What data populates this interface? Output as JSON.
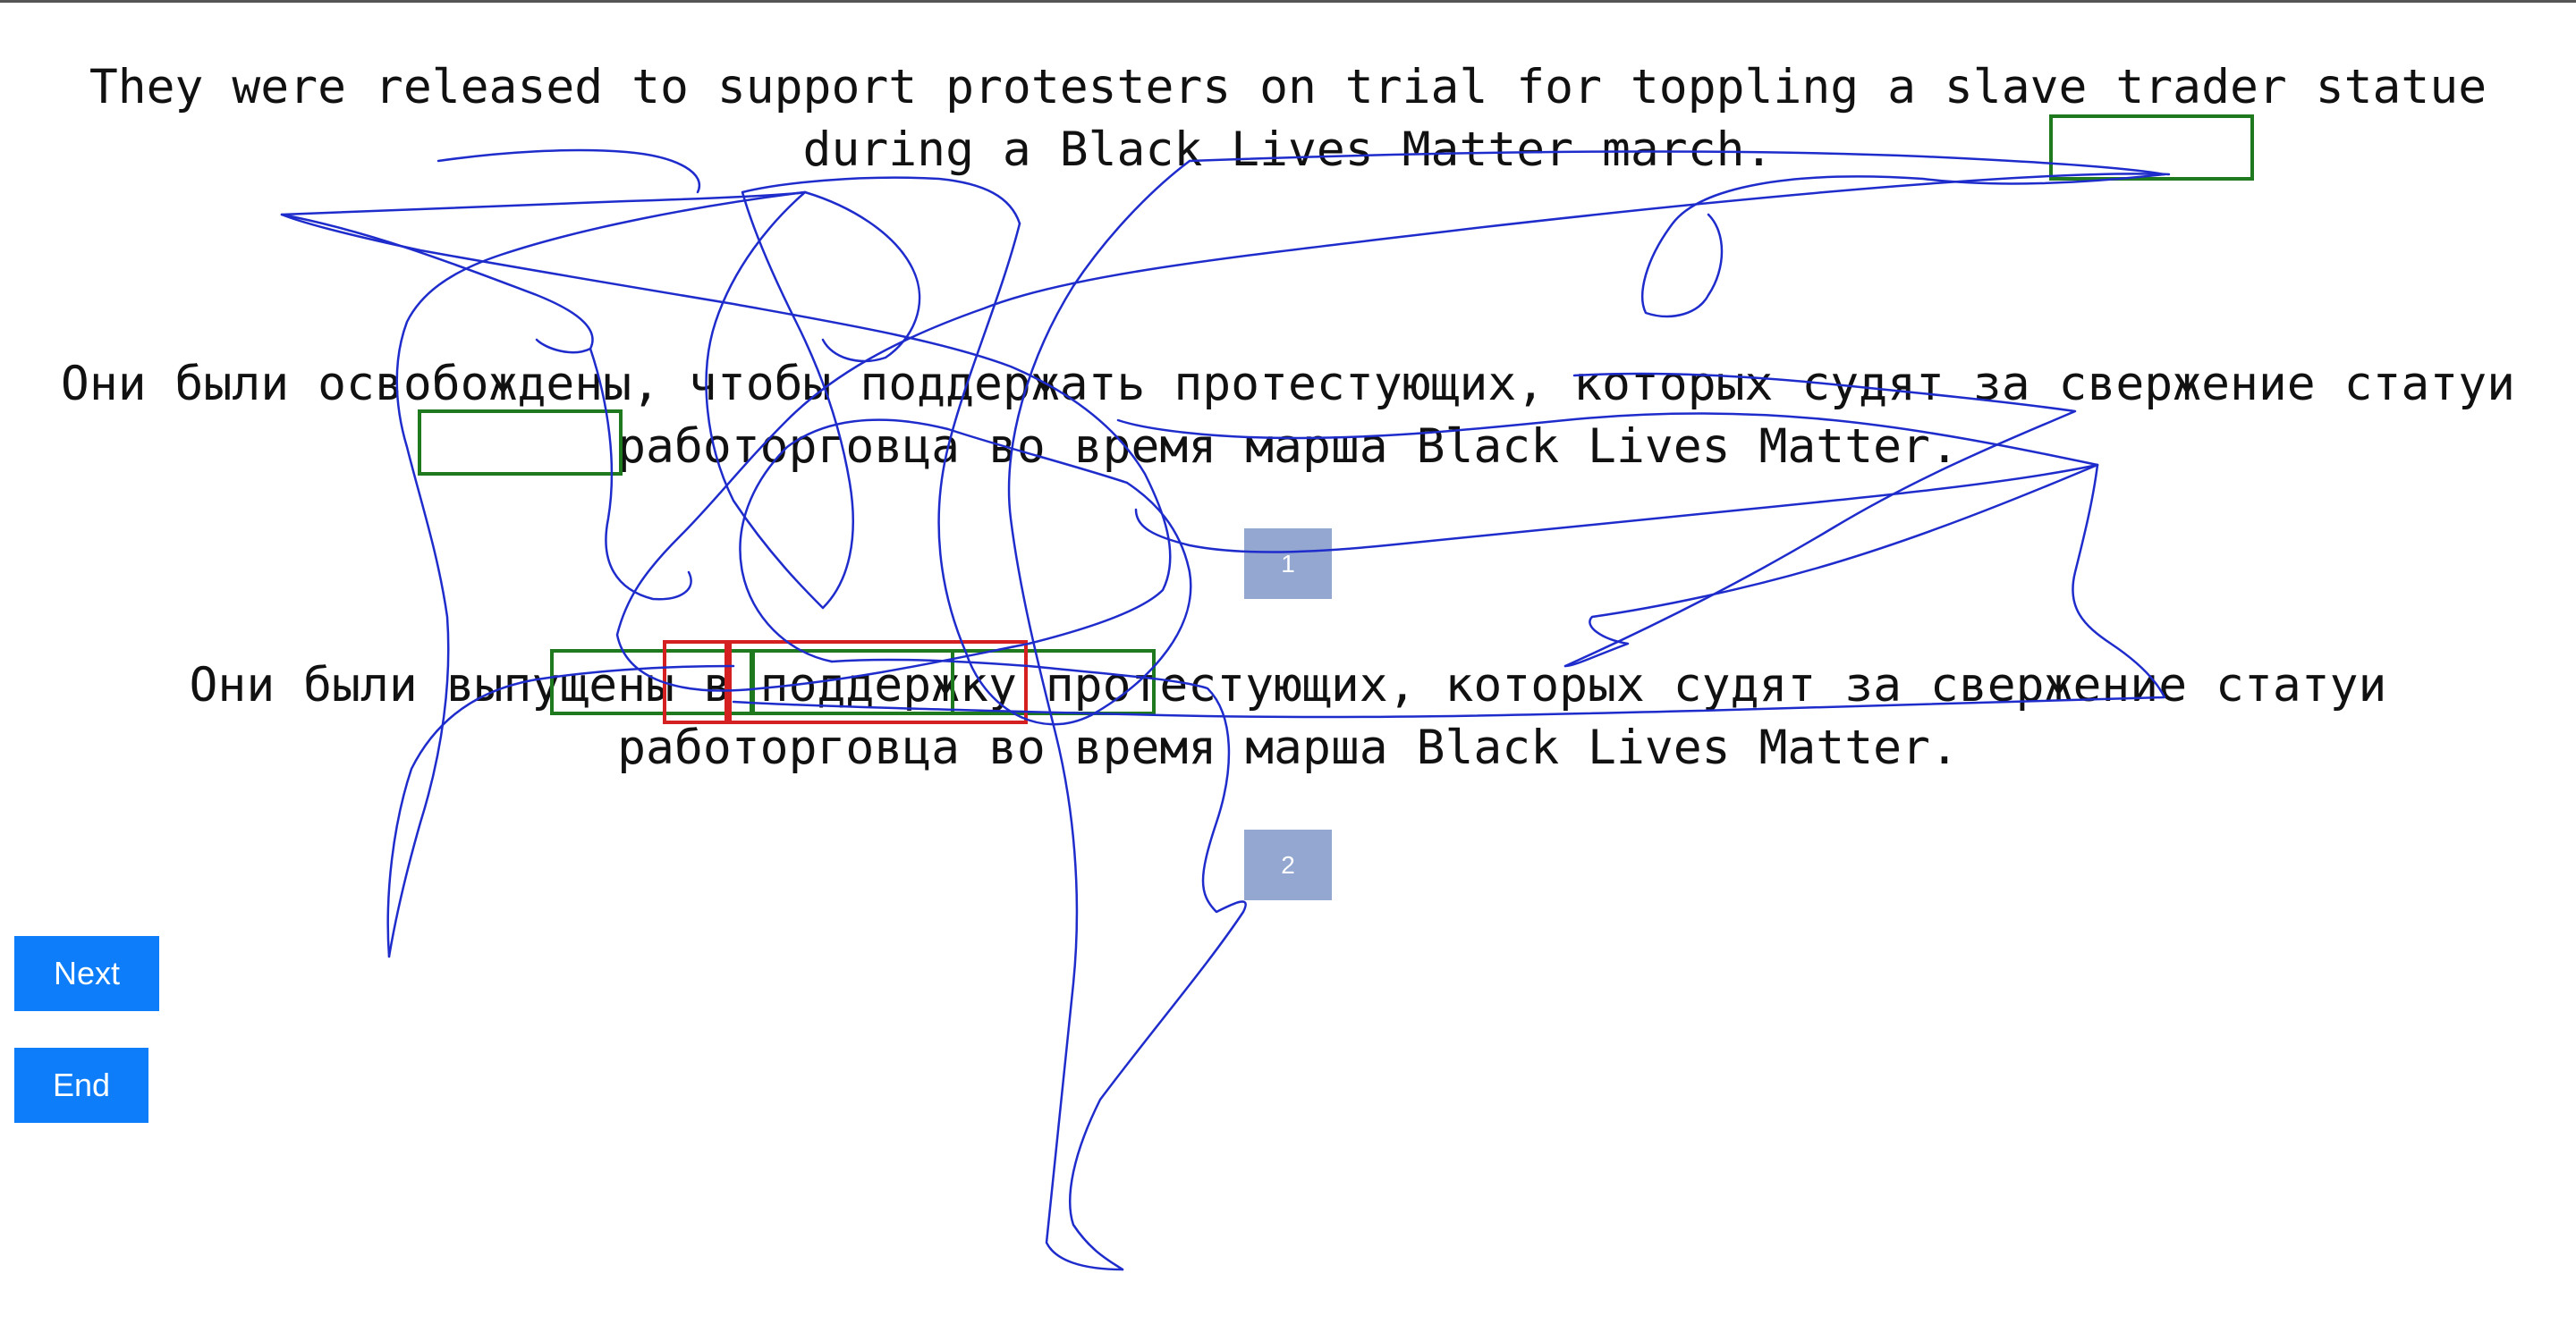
{
  "source": {
    "text": "They were released to support protesters on trial for toppling a slave trader statue during a Black Lives Matter march."
  },
  "translations": [
    {
      "text": "Они были освобождены, чтобы поддержать протестующих, которых судят за свержение статуи работорговца во время марша Black Lives Matter.",
      "rank": "1"
    },
    {
      "text": "Они были выпущены в поддержку протестующих, которых судят за свержение статуи работорговца во время марша Black Lives Matter.",
      "rank": "2"
    }
  ],
  "buttons": {
    "next_label": "Next",
    "end_label": "End"
  },
  "colors": {
    "button": "#0d7dfa",
    "badge": "#93a7d0",
    "gaze_trace": "#1f2ccc",
    "highlight_green": "#1f7a1f",
    "highlight_red": "#d42020"
  }
}
